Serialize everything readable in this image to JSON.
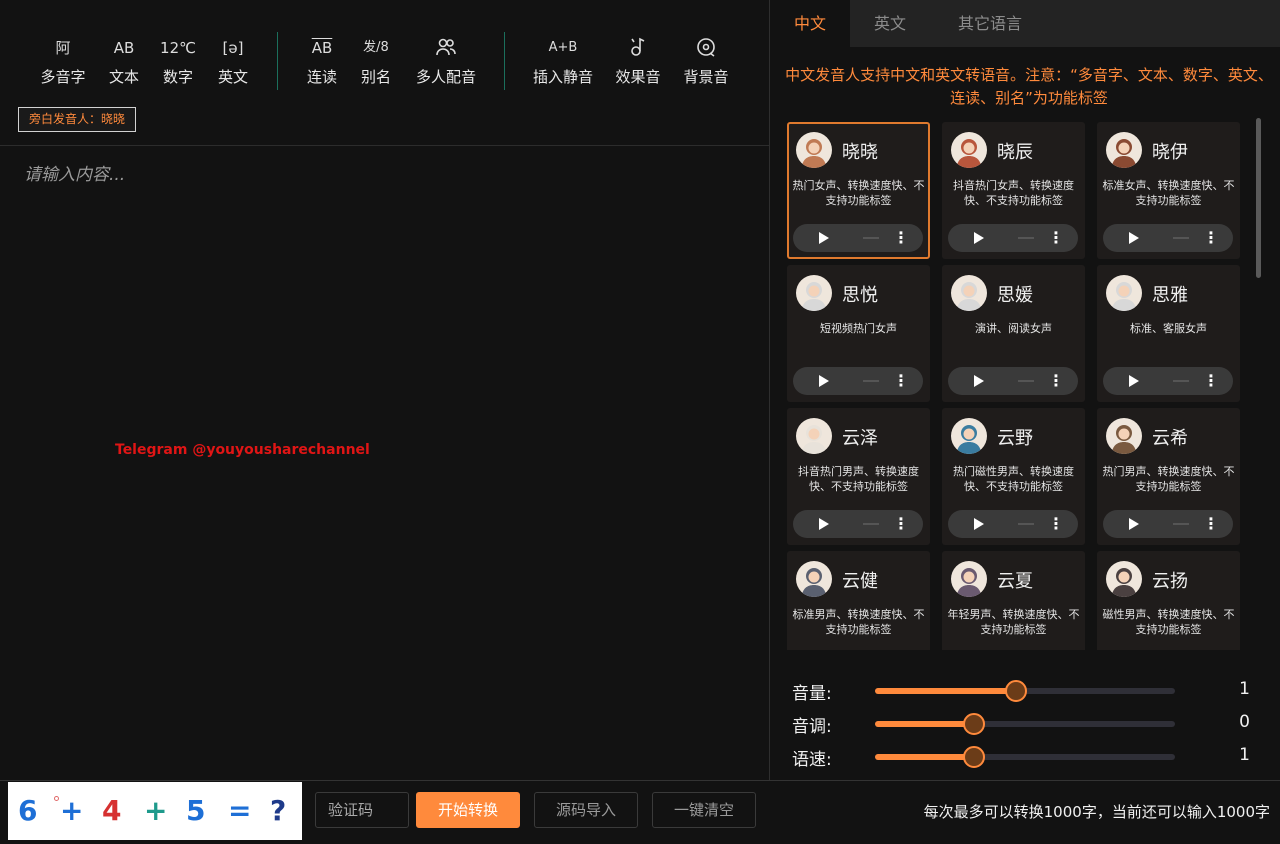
{
  "toolbar": {
    "groups": [
      [
        {
          "icon_text": "阿",
          "label": "多音字",
          "icon": "polyphone-icon"
        },
        {
          "icon_text": "AB",
          "label": "文本",
          "icon": "text-icon"
        },
        {
          "icon_text": "12℃",
          "label": "数字",
          "icon": "number-icon"
        },
        {
          "icon_text": "[ə]",
          "label": "英文",
          "icon": "english-phonetic-icon"
        }
      ],
      [
        {
          "icon_text": "AB",
          "label": "连读",
          "icon": "liaison-icon"
        },
        {
          "icon_text": "发/8",
          "label": "别名",
          "icon": "alias-icon"
        },
        {
          "icon_text": "",
          "label": "多人配音",
          "icon": "multi-speaker-icon"
        }
      ],
      [
        {
          "icon_text": "A+B",
          "label": "插入静音",
          "icon": "insert-silence-icon"
        },
        {
          "icon_text": "",
          "label": "效果音",
          "icon": "sound-effect-icon"
        },
        {
          "icon_text": "",
          "label": "背景音",
          "icon": "background-music-icon"
        }
      ]
    ],
    "narrator": "旁白发音人：晓晓"
  },
  "editor": {
    "placeholder": "请输入内容..."
  },
  "watermark": "Telegram  @youyousharechannel",
  "tabs": [
    {
      "label": "中文",
      "active": true
    },
    {
      "label": "英文",
      "active": false
    },
    {
      "label": "其它语言",
      "active": false
    }
  ],
  "notice": "中文发音人支持中文和英文转语音。注意：“多音字、文本、数字、英文、连读、别名”为功能标签",
  "voices": [
    {
      "name": "晓晓",
      "desc": "热门女声、转换速度快、不支持功能标签",
      "selected": true,
      "avatar": "female-avatar-icon",
      "color": "#c07a54"
    },
    {
      "name": "晓辰",
      "desc": "抖音热门女声、转换速度快、不支持功能标签",
      "selected": false,
      "avatar": "female-avatar-icon",
      "color": "#b8563c"
    },
    {
      "name": "晓伊",
      "desc": "标准女声、转换速度快、不支持功能标签",
      "selected": false,
      "avatar": "female-avatar-icon",
      "color": "#8a4a32"
    },
    {
      "name": "思悦",
      "desc": "短视频热门女声",
      "selected": false,
      "avatar": "default-avatar-icon",
      "color": "#d8d8d8"
    },
    {
      "name": "思媛",
      "desc": "演讲、阅读女声",
      "selected": false,
      "avatar": "default-avatar-icon",
      "color": "#d8d8d8"
    },
    {
      "name": "思雅",
      "desc": "标准、客服女声",
      "selected": false,
      "avatar": "default-avatar-icon",
      "color": "#d8d8d8"
    },
    {
      "name": "云泽",
      "desc": "抖音热门男声、转换速度快、不支持功能标签",
      "selected": false,
      "avatar": "elder-avatar-icon",
      "color": "#e8e2da"
    },
    {
      "name": "云野",
      "desc": "热门磁性男声、转换速度快、不支持功能标签",
      "selected": false,
      "avatar": "male-avatar-icon",
      "color": "#3a7ca0"
    },
    {
      "name": "云希",
      "desc": "热门男声、转换速度快、不支持功能标签",
      "selected": false,
      "avatar": "male-avatar-icon",
      "color": "#7a5a40"
    },
    {
      "name": "云健",
      "desc": "标准男声、转换速度快、不支持功能标签",
      "selected": false,
      "avatar": "male-avatar-icon",
      "color": "#5a6070"
    },
    {
      "name": "云夏",
      "desc": "年轻男声、转换速度快、不支持功能标签",
      "selected": false,
      "avatar": "male-avatar-icon",
      "color": "#6a5a70"
    },
    {
      "name": "云扬",
      "desc": "磁性男声、转换速度快、不支持功能标签",
      "selected": false,
      "avatar": "male-avatar-icon",
      "color": "#4a4040"
    }
  ],
  "sliders": [
    {
      "label": "音量:",
      "value": "1",
      "level": 0.47
    },
    {
      "label": "音调:",
      "value": "0",
      "level": 0.33
    },
    {
      "label": "语速:",
      "value": "1",
      "level": 0.33
    }
  ],
  "captcha": [
    "6",
    "+",
    "4",
    "+",
    "5",
    "=",
    "?"
  ],
  "captcha_colors": [
    "#1e6fd6",
    "#1e6fd6",
    "#d63030",
    "#1e9a8c",
    "#1e6fd6",
    "#1e6fd6",
    "#1e3a8a"
  ],
  "bottom": {
    "vcode_placeholder": "验证码",
    "start": "开始转换",
    "import": "源码导入",
    "clear": "一键清空",
    "counter": "每次最多可以转换1000字，当前还可以输入1000字"
  },
  "colors": {
    "accent": "#ff8a3c",
    "watermark": "#e01515"
  }
}
